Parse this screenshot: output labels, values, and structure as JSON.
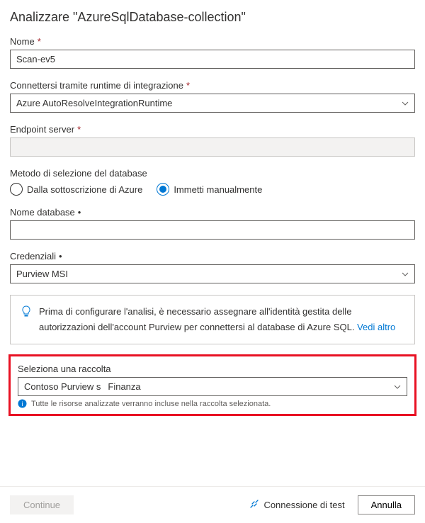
{
  "title": "Analizzare \"AzureSqlDatabase-collection\"",
  "fields": {
    "name": {
      "label": "Nome",
      "value": "Scan-ev5"
    },
    "runtime": {
      "label": "Connettersi tramite runtime di integrazione",
      "value": "Azure AutoResolveIntegrationRuntime"
    },
    "endpoint": {
      "label": "Endpoint server",
      "value": ""
    },
    "dbmethod": {
      "label": "Metodo di selezione del database",
      "opt_subscription": "Dalla sottoscrizione di Azure",
      "opt_manual": "Immetti manualmente",
      "selected": "manual"
    },
    "dbname": {
      "label": "Nome database",
      "value": ""
    },
    "credentials": {
      "label": "Credenziali",
      "value": "Purview MSI"
    }
  },
  "info": {
    "text_a": "Prima di configurare l'analisi, è necessario assegnare all'identità gestita delle autorizzazioni dell'account Purview per connettersi al database di Azure SQL. ",
    "link": "Vedi altro"
  },
  "collection": {
    "label": "Seleziona una raccolta",
    "part1": "Contoso Purview s",
    "part2": "Finanza",
    "hint": "Tutte le risorse analizzate verranno incluse nella raccolta selezionata."
  },
  "footer": {
    "continue": "Continue",
    "test": "Connessione di test",
    "cancel": "Annulla"
  }
}
